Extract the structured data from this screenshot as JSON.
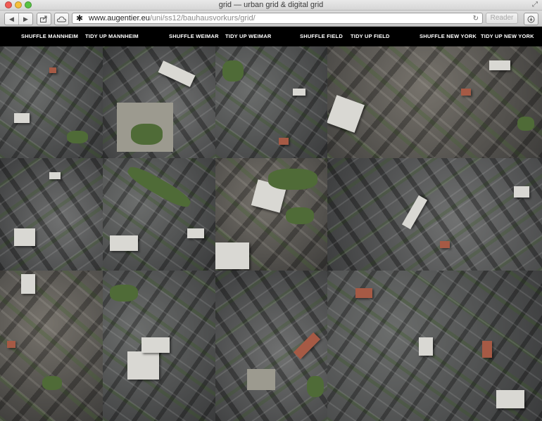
{
  "window": {
    "title": "grid — urban grid & digital grid",
    "fullscreen_glyph": "⤢"
  },
  "toolbar": {
    "back_glyph": "◀",
    "forward_glyph": "▶",
    "share_icon": "share-icon",
    "cloud_icon": "cloud-icon",
    "url_star": "✱",
    "url_domain": "www.augentier.eu",
    "url_path": "/uni/ss12/bauhausvorkurs/grid/",
    "reload_glyph": "↻",
    "reader_label": "Reader",
    "download_icon": "download-icon"
  },
  "nav": {
    "items": [
      {
        "label": "Shuffle Mannheim"
      },
      {
        "label": "Tidy up Mannheim"
      },
      {
        "label": "Shuffle Weimar"
      },
      {
        "label": "Tidy up Weimar"
      },
      {
        "label": "Shuffle Field"
      },
      {
        "label": "Tidy up Field"
      },
      {
        "label": "Shuffle New York"
      },
      {
        "label": "Tidy up New York"
      }
    ]
  },
  "colors": {
    "nav_bg": "#000000",
    "nav_text": "#ffffff",
    "url_domain": "#222222",
    "url_path": "#8a8a8a"
  }
}
